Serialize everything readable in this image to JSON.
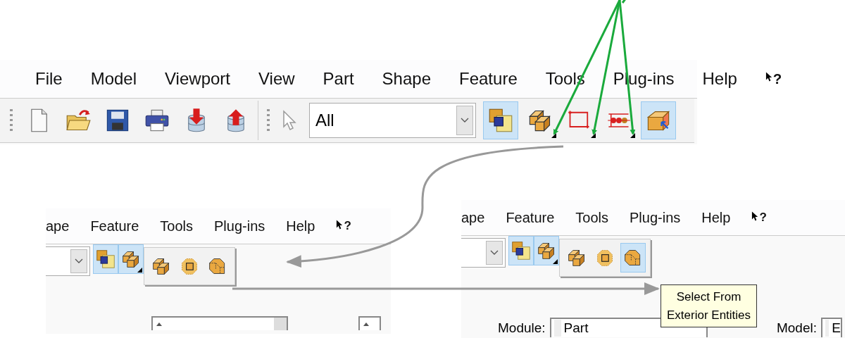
{
  "main": {
    "menu": [
      {
        "label": "File"
      },
      {
        "label": "Model"
      },
      {
        "label": "Viewport"
      },
      {
        "label": "View"
      },
      {
        "label": "Part"
      },
      {
        "label": "Shape"
      },
      {
        "label": "Feature"
      },
      {
        "label": "Tools"
      },
      {
        "label": "Plug-ins"
      },
      {
        "label": "Help"
      }
    ],
    "context_help": "?",
    "file_tools": [
      {
        "kind": "new"
      },
      {
        "kind": "open"
      },
      {
        "kind": "save"
      },
      {
        "kind": "print"
      },
      {
        "kind": "import"
      },
      {
        "kind": "export"
      }
    ],
    "selection_filter": {
      "value": "All"
    },
    "select_tools": [
      {
        "kind": "overlap",
        "selected": true,
        "dropdown": false
      },
      {
        "kind": "cube",
        "selected": false,
        "dropdown": true
      },
      {
        "kind": "rect",
        "selected": false,
        "dropdown": true
      },
      {
        "kind": "chain",
        "selected": false,
        "dropdown": true
      },
      {
        "kind": "cube-arrow",
        "selected": true,
        "dropdown": false
      }
    ]
  },
  "panels": [
    {
      "menu": [
        {
          "label": "ape"
        },
        {
          "label": "Feature"
        },
        {
          "label": "Tools"
        },
        {
          "label": "Plug-ins"
        },
        {
          "label": "Help"
        }
      ],
      "context_help": "?",
      "tools": [
        {
          "kind": "overlap",
          "selected": true,
          "dropdown": false
        },
        {
          "kind": "cube",
          "selected": true,
          "dropdown": true
        }
      ],
      "flyout": [
        {
          "kind": "cube",
          "selected": false
        },
        {
          "kind": "cube-dashed",
          "selected": false
        },
        {
          "kind": "cube-hidden",
          "selected": false
        }
      ]
    },
    {
      "menu": [
        {
          "label": "ape"
        },
        {
          "label": "Feature"
        },
        {
          "label": "Tools"
        },
        {
          "label": "Plug-ins"
        },
        {
          "label": "Help"
        }
      ],
      "context_help": "?",
      "tools": [
        {
          "kind": "overlap",
          "selected": true,
          "dropdown": false
        },
        {
          "kind": "cube",
          "selected": true,
          "dropdown": true
        }
      ],
      "flyout": [
        {
          "kind": "cube",
          "selected": false
        },
        {
          "kind": "cube-dashed",
          "selected": false
        },
        {
          "kind": "cube-hidden",
          "selected": true
        }
      ],
      "tooltip": [
        "Select From",
        "Exterior Entities"
      ],
      "module": {
        "label": "Module:",
        "value": "Part"
      },
      "model": {
        "label": "Model:",
        "value": "E"
      }
    }
  ]
}
